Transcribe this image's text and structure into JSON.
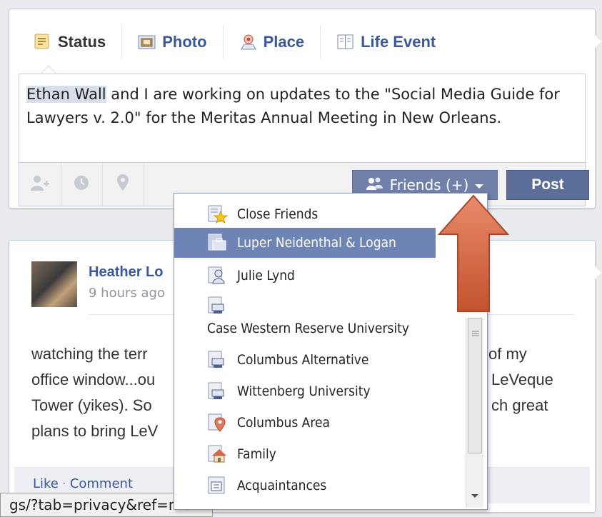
{
  "composer": {
    "tabs": [
      {
        "label": "Status",
        "icon": "status-icon",
        "active": true
      },
      {
        "label": "Photo",
        "icon": "photo-icon"
      },
      {
        "label": "Place",
        "icon": "place-icon"
      },
      {
        "label": "Life Event",
        "icon": "life-event-icon"
      }
    ],
    "text_tag": "Ethan Wall",
    "text_rest": " and I are working on updates to the \"Social Media Guide for Lawyers v. 2.0\" for the Meritas Annual Meeting in New Orleans.",
    "tool_icons": [
      "tag-friends-icon",
      "clock-icon",
      "location-icon"
    ],
    "audience_label": "Friends (+)",
    "post_label": "Post"
  },
  "audience_menu": {
    "items": [
      {
        "label": "Close Friends",
        "icon": "star-list-icon",
        "selected": false
      },
      {
        "label": "Luper Neidenthal & Logan",
        "icon": "work-list-icon",
        "selected": true
      },
      {
        "label": "Julie Lynd",
        "icon": "person-list-icon",
        "selected": false
      },
      {
        "label": "Case Western Reserve University",
        "icon": "school-list-icon",
        "selected": false
      },
      {
        "label": "Columbus Alternative",
        "icon": "school-list-icon",
        "selected": false
      },
      {
        "label": "Wittenberg University",
        "icon": "school-list-icon",
        "selected": false
      },
      {
        "label": "Columbus Area",
        "icon": "location-list-icon",
        "selected": false
      },
      {
        "label": "Family",
        "icon": "home-list-icon",
        "selected": false
      },
      {
        "label": "Acquaintances",
        "icon": "acquaintances-list-icon",
        "selected": false
      }
    ]
  },
  "feed_post": {
    "author": "Heather Lo",
    "time": "9 hours ago",
    "lines": [
      {
        "left": "watching the terr",
        "right": "of my"
      },
      {
        "left": "office window...ou",
        "right": "LeVeque"
      },
      {
        "left": "Tower (yikes). So",
        "right": "ch great"
      },
      {
        "left": "plans to bring LeV",
        "right": ""
      }
    ],
    "like_label": "Like",
    "separator": "·",
    "comment_label": "Comment"
  },
  "status_bar_url": "gs/?tab=privacy&ref=mb#",
  "colors": {
    "brand_blue": "#3b5998",
    "selected_item": "#6d84b4",
    "annotation_arrow": "#d9684a"
  }
}
